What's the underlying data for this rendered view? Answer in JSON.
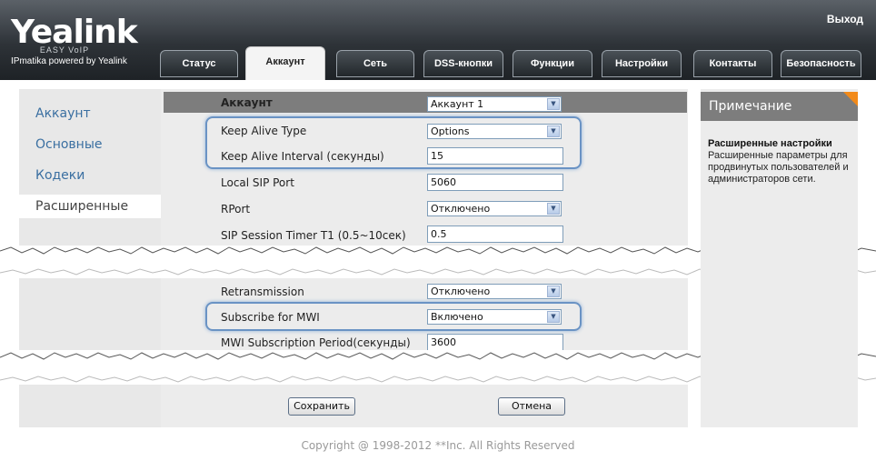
{
  "header": {
    "brand": "Yealink",
    "brand_sub": "EASY VoIP",
    "tagline": "IPmatika powered by Yealink",
    "exit_label": "Выход"
  },
  "tabs": [
    {
      "label": "Статус"
    },
    {
      "label": "Аккаунт",
      "active": true
    },
    {
      "label": "Сеть"
    },
    {
      "label": "DSS-кнопки"
    },
    {
      "label": "Функции"
    },
    {
      "label": "Настройки"
    },
    {
      "label": "Контакты"
    },
    {
      "label": "Безопасность"
    }
  ],
  "sidebar": {
    "items": [
      {
        "label": "Аккаунт"
      },
      {
        "label": "Основные"
      },
      {
        "label": "Кодеки"
      },
      {
        "label": "Расширенные",
        "active": true
      }
    ]
  },
  "form": {
    "account_label": "Аккаунт",
    "account_value": "Аккаунт 1",
    "keep_alive_type_label": "Keep Alive Type",
    "keep_alive_type_value": "Options",
    "keep_alive_interval_label": "Keep Alive Interval  (секунды)",
    "keep_alive_interval_value": "15",
    "local_sip_port_label": "Local SIP Port",
    "local_sip_port_value": "5060",
    "rport_label": "RPort",
    "rport_value": "Отключено",
    "sip_timer_label": "SIP Session Timer T1 (0.5~10сек)",
    "sip_timer_value": "0.5",
    "retransmission_label": "Retransmission",
    "retransmission_value": "Отключено",
    "subscribe_mwi_label": "Subscribe for MWI",
    "subscribe_mwi_value": "Включено",
    "mwi_period_label": "MWI Subscription Period(секунды)",
    "mwi_period_value": "3600",
    "save_label": "Сохранить",
    "cancel_label": "Отмена"
  },
  "note": {
    "header": "Примечание",
    "title": "Расширенные настройки",
    "text": "Расширенные параметры для продвинутых пользователей и администраторов сети."
  },
  "footer": {
    "copyright": "Copyright @ 1998-2012 **Inc. All Rights Reserved"
  },
  "colors": {
    "accent": "#6a93c4",
    "note_corner": "#f28a1a",
    "link_blue": "#3a6fa1"
  }
}
